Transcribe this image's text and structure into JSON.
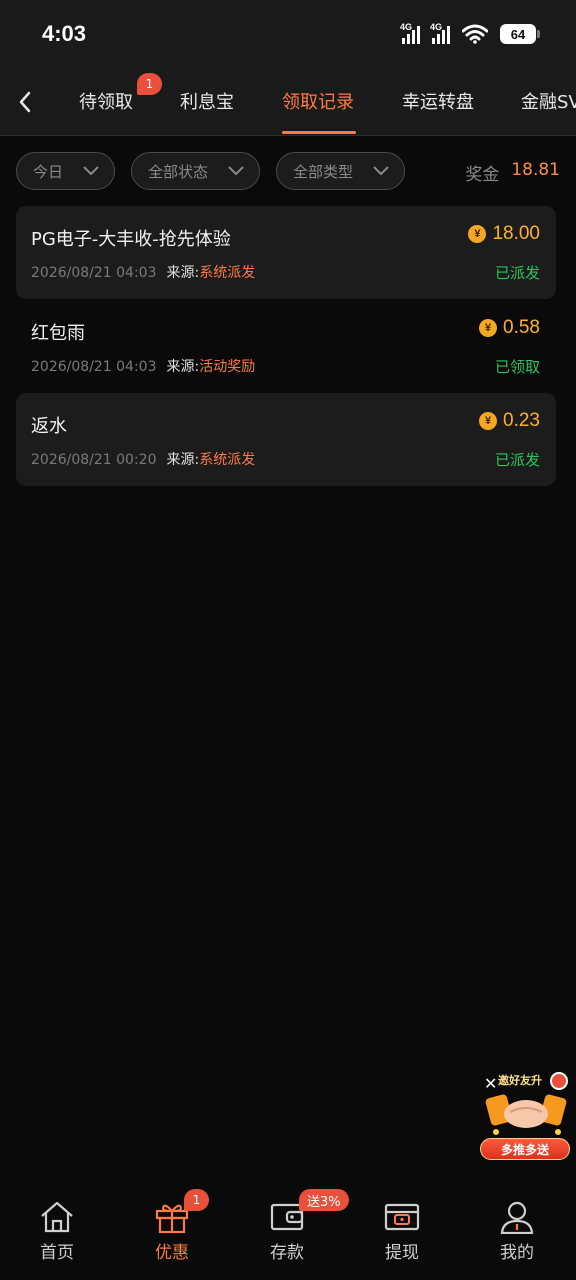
{
  "status_bar": {
    "time": "4:03",
    "signal1_label": "4G",
    "signal2_label": "4G",
    "battery": "64"
  },
  "tabs": [
    {
      "label": "待领取",
      "badge": "1"
    },
    {
      "label": "利息宝"
    },
    {
      "label": "领取记录",
      "active": true
    },
    {
      "label": "幸运转盘"
    },
    {
      "label": "金融SV"
    }
  ],
  "filters": {
    "date": "今日",
    "status": "全部状态",
    "type": "全部类型",
    "bonus_label": "奖金",
    "bonus_value": "18.81"
  },
  "records": [
    {
      "title": "PG电子-大丰收-抢先体验",
      "amount": "18.00",
      "date": "2026/08/21 04:03",
      "source_label": "来源:",
      "source": "系统派发",
      "status": "已派发"
    },
    {
      "title": "红包雨",
      "amount": "0.58",
      "date": "2026/08/21 04:03",
      "source_label": "来源:",
      "source": "活动奖励",
      "status": "已领取"
    },
    {
      "title": "返水",
      "amount": "0.23",
      "date": "2026/08/21 00:20",
      "source_label": "来源:",
      "source": "系统派发",
      "status": "已派发"
    }
  ],
  "currency_symbol": "¥",
  "promo": {
    "close": "✕",
    "top_text": "邀好友升",
    "button": "多推多送"
  },
  "bottom_nav": [
    {
      "label": "首页",
      "icon": "home-icon"
    },
    {
      "label": "优惠",
      "icon": "gift-icon",
      "active": true,
      "badge": "1"
    },
    {
      "label": "存款",
      "icon": "wallet-icon",
      "tag": "送3%"
    },
    {
      "label": "提现",
      "icon": "withdraw-icon"
    },
    {
      "label": "我的",
      "icon": "user-icon"
    }
  ],
  "colors": {
    "accent": "#ff7a45",
    "amount": "#ffb02e",
    "success": "#2fc25b",
    "badge": "#e9503b",
    "background": "#0a0a0a",
    "card": "#1c1c1c"
  }
}
